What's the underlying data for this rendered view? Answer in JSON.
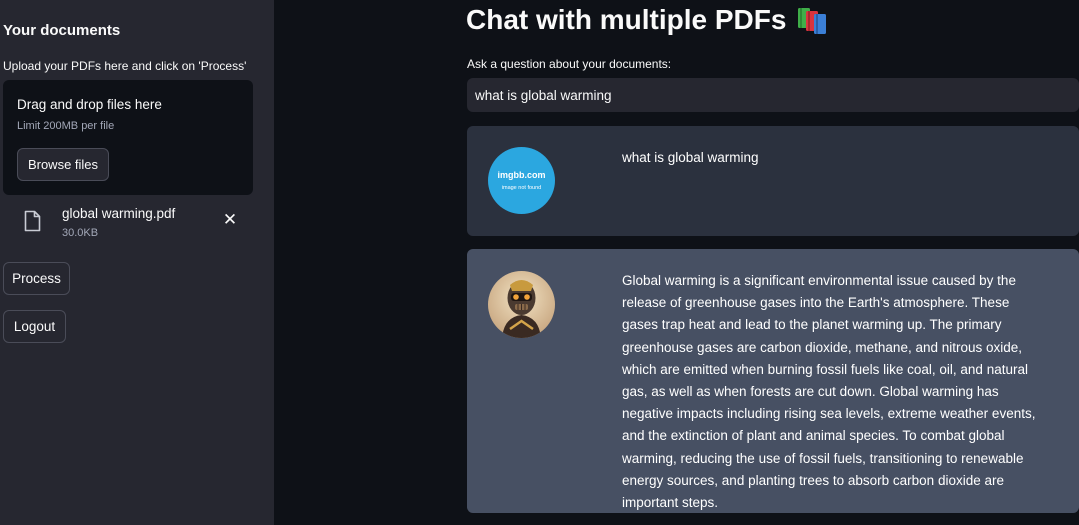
{
  "sidebar": {
    "title": "Your documents",
    "subtitle": "Upload your PDFs here and click on 'Process'",
    "uploader": {
      "drop_label": "Drag and drop files here",
      "limit": "Limit 200MB per file",
      "browse_label": "Browse files"
    },
    "file": {
      "name": "global warming.pdf",
      "size": "30.0KB",
      "icon": "file-icon",
      "remove_icon": "close-icon",
      "remove_glyph": "✕"
    },
    "process_label": "Process",
    "logout_label": "Logout"
  },
  "main": {
    "title": "Chat with multiple PDFs",
    "title_icon": "books-icon",
    "question_label": "Ask a question about your documents:",
    "question_value": "what is global warming",
    "messages": [
      {
        "role": "user",
        "avatar_brand": "imgbb.com",
        "avatar_note": "image not found",
        "text": "what is global warming"
      },
      {
        "role": "bot",
        "avatar": "robot-avatar",
        "text": "Global warming is a significant environmental issue caused by the release of greenhouse gases into the Earth's atmosphere. These gases trap heat and lead to the planet warming up. The primary greenhouse gases are carbon dioxide, methane, and nitrous oxide, which are emitted when burning fossil fuels like coal, oil, and natural gas, as well as when forests are cut down. Global warming has negative impacts including rising sea levels, extreme weather events, and the extinction of plant and animal species. To combat global warming, reducing the use of fossil fuels, transitioning to renewable energy sources, and planting trees to absorb carbon dioxide are important steps."
      }
    ]
  },
  "colors": {
    "background": "#0e1117",
    "sidebar": "#262730",
    "user_message": "#2b313e",
    "bot_message": "#475063",
    "avatar_user": "#2ba7e0"
  }
}
